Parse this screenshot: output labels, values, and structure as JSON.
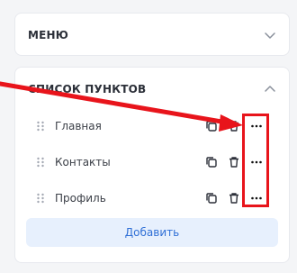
{
  "menu_panel": {
    "title": "МЕНЮ"
  },
  "list_panel": {
    "title": "СПИСОК ПУНКТОВ",
    "items": [
      {
        "label": "Главная"
      },
      {
        "label": "Контакты"
      },
      {
        "label": "Профиль"
      }
    ],
    "add_label": "Добавить"
  },
  "colors": {
    "accent": "#2f6fd6",
    "add_button_bg": "#e7f0fd",
    "annotation_red": "#e8141b"
  },
  "icons": {
    "menu_toggle": "chevron-down-icon",
    "list_toggle": "chevron-up-icon",
    "drag": "drag-handle-icon",
    "copy": "copy-icon",
    "trash": "trash-icon",
    "more": "more-horizontal-icon"
  }
}
